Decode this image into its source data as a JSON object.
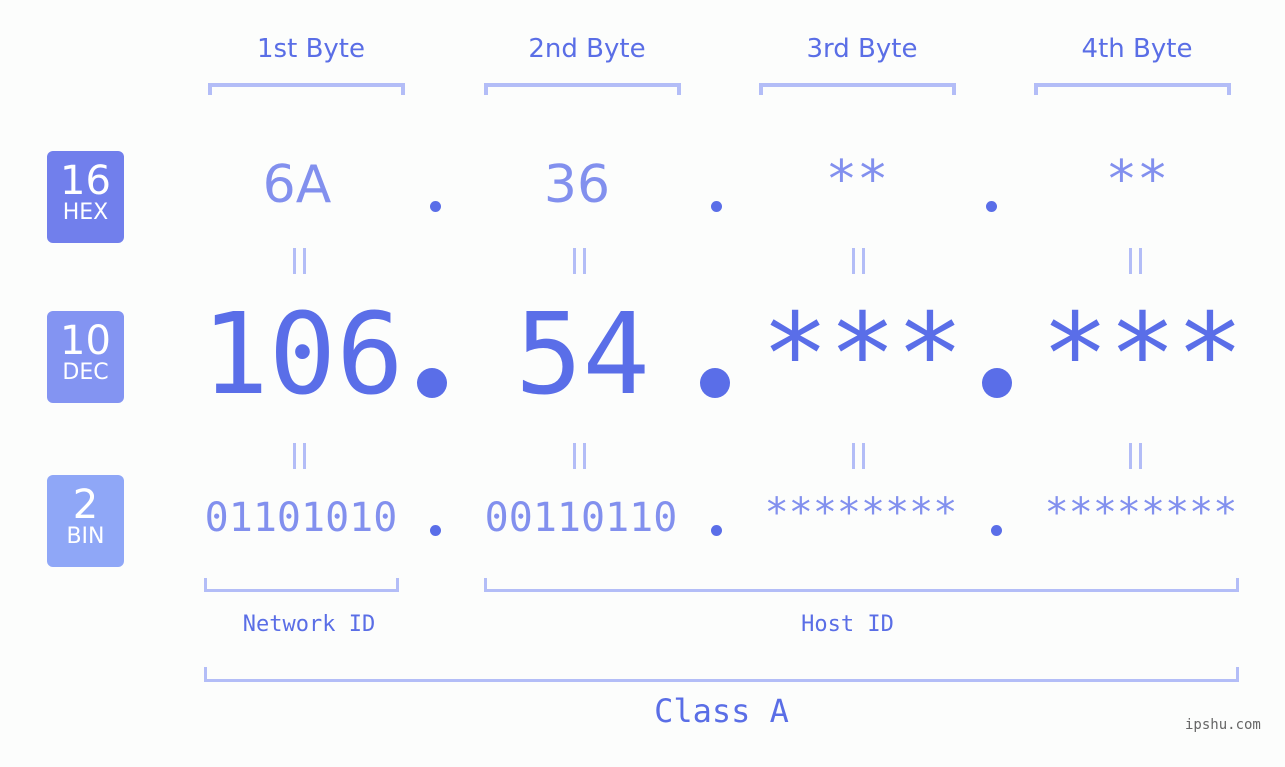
{
  "byte_headers": [
    "1st Byte",
    "2nd Byte",
    "3rd Byte",
    "4th Byte"
  ],
  "rows": {
    "hex": {
      "base": "16",
      "label": "HEX",
      "color": "#717fec",
      "values": [
        "6A",
        "36",
        "**",
        "**"
      ]
    },
    "dec": {
      "base": "10",
      "label": "DEC",
      "color": "#8394f2",
      "values": [
        "106",
        "54",
        "***",
        "***"
      ]
    },
    "bin": {
      "base": "2",
      "label": "BIN",
      "color": "#8fa7f7",
      "values": [
        "01101010",
        "00110110",
        "********",
        "********"
      ]
    }
  },
  "separator": ".",
  "network_id_label": "Network ID",
  "host_id_label": "Host ID",
  "class_label": "Class A",
  "watermark": "ipshu.com"
}
